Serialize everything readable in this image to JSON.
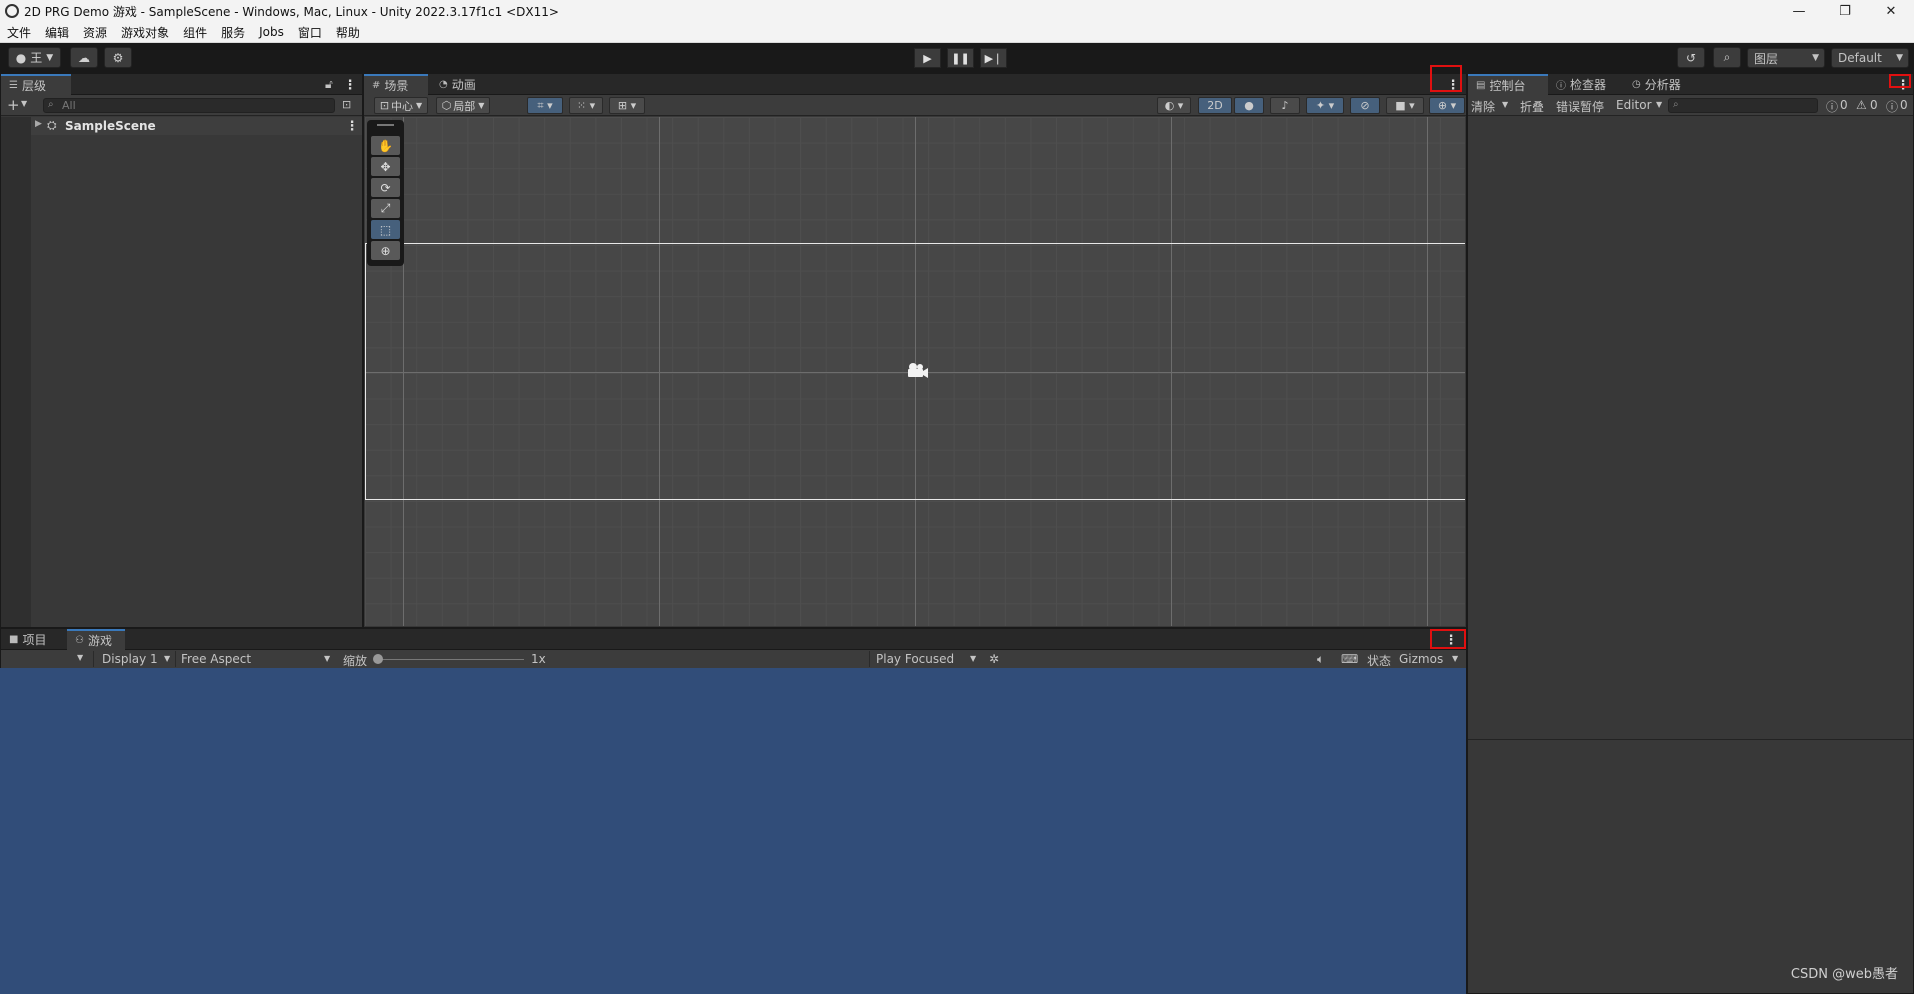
{
  "window": {
    "title": "2D PRG Demo 游戏 - SampleScene - Windows, Mac, Linux - Unity 2022.3.17f1c1 <DX11>",
    "minimize": "—",
    "maximize": "❐",
    "close": "✕"
  },
  "menu": [
    "文件",
    "编辑",
    "资源",
    "游戏对象",
    "组件",
    "服务",
    "Jobs",
    "窗口",
    "帮助"
  ],
  "toolbar": {
    "account_label": "王",
    "layers_label": "图层",
    "layout_label": "Default"
  },
  "hierarchy": {
    "tab_label": "层级",
    "search_placeholder": "All",
    "scene_item": "SampleScene"
  },
  "scene": {
    "tab_scene": "场景",
    "tab_animation": "动画",
    "pivot_label": "中心",
    "space_label": "局部",
    "mode_2d": "2D"
  },
  "console": {
    "tab_console": "控制台",
    "tab_inspector": "检查器",
    "tab_profiler": "分析器",
    "clear_label": "清除",
    "collapse_label": "折叠",
    "error_pause_label": "错误暂停",
    "editor_label": "Editor",
    "info_count": "0",
    "warn_count": "0",
    "error_count": "0"
  },
  "game": {
    "tab_project": "项目",
    "tab_game": "游戏",
    "display_label": "Display 1",
    "aspect_label": "Free Aspect",
    "scale_label": "缩放",
    "scale_value": "1x",
    "play_focused_label": "Play Focused",
    "stats_label": "状态",
    "gizmos_label": "Gizmos"
  },
  "watermark": "CSDN @web愚者",
  "colors": {
    "game_background": "#314d79",
    "highlight_box": "#e01010",
    "accent_blue": "#46607c"
  }
}
